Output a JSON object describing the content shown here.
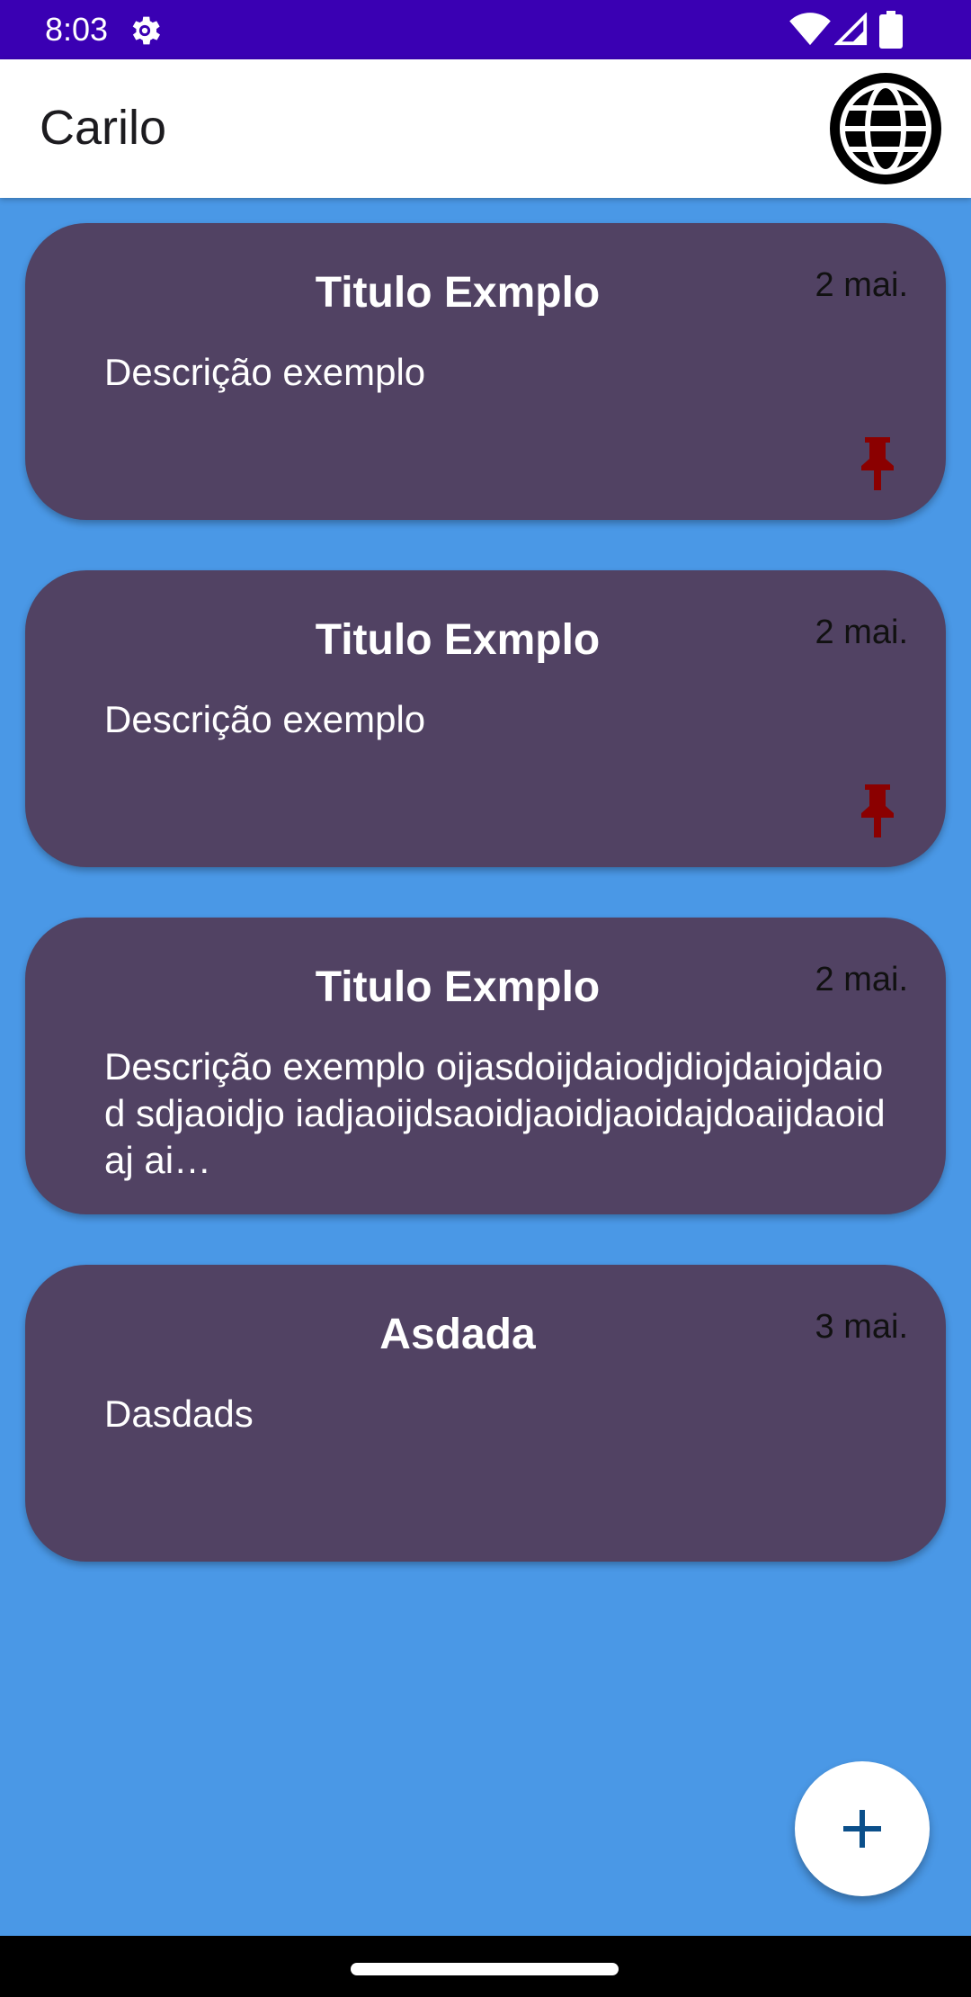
{
  "status_bar": {
    "time": "8:03",
    "icons": [
      "settings-gear-icon",
      "wifi-icon",
      "cell-signal-icon",
      "battery-icon"
    ]
  },
  "app_bar": {
    "title": "Carilo",
    "action_icon": "globe-icon"
  },
  "notes": [
    {
      "title": "Titulo Exmplo",
      "date": "2 mai.",
      "description": "Descrição exemplo",
      "pinned": true
    },
    {
      "title": "Titulo Exmplo",
      "date": "2 mai.",
      "description": "Descrição exemplo",
      "pinned": true
    },
    {
      "title": "Titulo Exmplo",
      "date": "2 mai.",
      "description": "Descrição exemplo oijasdoijdaiodjdiojdaiojdaiod sdjaoidjo iadjaoijdsaoidjaoidjaoidajdoaijdaoidaj ai…",
      "pinned": false
    },
    {
      "title": "Asdada",
      "date": "3 mai.",
      "description": "Dasdads",
      "pinned": false
    }
  ],
  "fab": {
    "icon": "plus-icon"
  },
  "colors": {
    "status_bar": "#3a00b3",
    "background": "#4a98e6",
    "card": "#514263",
    "pin": "#8b0000",
    "fab_icon": "#0b4f8a"
  }
}
